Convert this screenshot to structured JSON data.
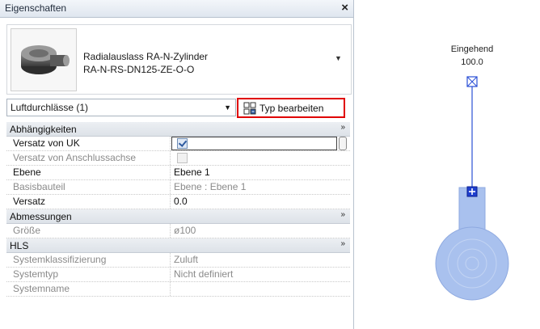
{
  "panel": {
    "title": "Eigenschaften",
    "close_glyph": "×",
    "type_name_line1": "Radialauslass RA-N-Zylinder",
    "type_name_line2": "RA-N-RS-DN125-ZE-O-O",
    "instance_filter": "Luftdurchlässe (1)",
    "edit_type_label": "Typ bearbeiten",
    "groups": [
      {
        "label": "Abhängigkeiten",
        "collapse_glyph": "»",
        "rows": [
          {
            "name": "Versatz von UK",
            "value": "",
            "checkbox": "checked",
            "readonly": false,
            "active": true
          },
          {
            "name": "Versatz von Anschlussachse",
            "value": "",
            "checkbox": "disabled",
            "readonly": true,
            "active": false
          },
          {
            "name": "Ebene",
            "value": "Ebene 1",
            "readonly": false
          },
          {
            "name": "Basisbauteil",
            "value": "Ebene : Ebene 1",
            "readonly": true
          },
          {
            "name": "Versatz",
            "value": "0.0",
            "readonly": false
          }
        ]
      },
      {
        "label": "Abmessungen",
        "collapse_glyph": "»",
        "rows": [
          {
            "name": "Größe",
            "value": "ø100",
            "readonly": true
          }
        ]
      },
      {
        "label": "HLS",
        "collapse_glyph": "»",
        "rows": [
          {
            "name": "Systemklassifizierung",
            "value": "Zuluft",
            "readonly": true
          },
          {
            "name": "Systemtyp",
            "value": "Nicht definiert",
            "readonly": true
          },
          {
            "name": "Systemname",
            "value": "",
            "readonly": true
          }
        ]
      }
    ]
  },
  "canvas": {
    "connector_label": "Eingehend",
    "connector_value": "100.0",
    "symbol_color": "#a9c1ee",
    "line_color": "#2a4fd6"
  },
  "colors": {
    "highlight_border": "#e00000",
    "accent": "#2d5aa0"
  }
}
